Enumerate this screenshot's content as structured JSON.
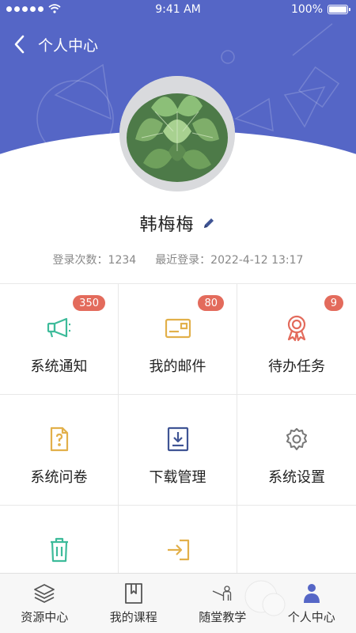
{
  "status_bar": {
    "time": "9:41 AM",
    "battery": "100%",
    "battery_level": 1.0
  },
  "nav": {
    "title": "个人中心",
    "back_icon": "chevron-left-icon"
  },
  "profile": {
    "name": "韩梅梅",
    "login_count": "登录次数：1234",
    "last_login": "最近登录：2022-4-12 13:17"
  },
  "grid": [
    {
      "label": "系统通知",
      "badge": "350",
      "icon": "megaphone-icon",
      "color": "#3dbb9a"
    },
    {
      "label": "我的邮件",
      "badge": "80",
      "icon": "mail-icon",
      "color": "#e2b04a"
    },
    {
      "label": "待办任务",
      "badge": "9",
      "icon": "award-icon",
      "color": "#e36b5c"
    },
    {
      "label": "系统问卷",
      "badge": "",
      "icon": "questionnaire-icon",
      "color": "#e2b04a"
    },
    {
      "label": "下载管理",
      "badge": "",
      "icon": "download-icon",
      "color": "#3f5494"
    },
    {
      "label": "系统设置",
      "badge": "",
      "icon": "gear-icon",
      "color": "#777777"
    },
    {
      "label": "",
      "badge": "",
      "icon": "trash-icon",
      "color": "#3dbb9a"
    },
    {
      "label": "",
      "badge": "",
      "icon": "login-icon",
      "color": "#e2b04a"
    },
    {
      "label": "",
      "badge": "",
      "icon": "",
      "color": ""
    }
  ],
  "tabs": [
    {
      "label": "资源中心",
      "icon": "layers-icon"
    },
    {
      "label": "我的课程",
      "icon": "book-icon"
    },
    {
      "label": "随堂教学",
      "icon": "teacher-icon"
    },
    {
      "label": "个人中心",
      "icon": "person-icon",
      "active": true
    }
  ],
  "colors": {
    "header": "#5566c6",
    "badge": "#e36b5c",
    "active_tab": "#5566c6"
  }
}
